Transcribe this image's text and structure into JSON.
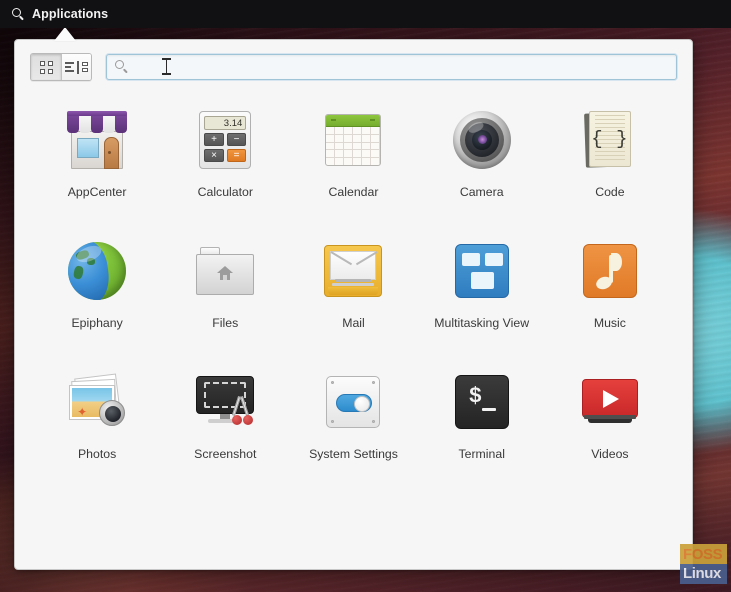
{
  "panel": {
    "menu_label": "Applications",
    "search_icon": "search-icon"
  },
  "toolbar": {
    "grid_view_icon": "grid-view-icon",
    "category_view_icon": "category-view-icon",
    "grid_view_active": true
  },
  "search": {
    "value": "",
    "placeholder": "",
    "icon": "magnifier-icon",
    "cursor": "text-ibeam-cursor"
  },
  "apps": [
    {
      "label": "AppCenter",
      "icon": "appcenter-icon"
    },
    {
      "label": "Calculator",
      "icon": "calculator-icon"
    },
    {
      "label": "Calendar",
      "icon": "calendar-icon"
    },
    {
      "label": "Camera",
      "icon": "camera-icon"
    },
    {
      "label": "Code",
      "icon": "code-icon"
    },
    {
      "label": "Epiphany",
      "icon": "epiphany-globe-icon"
    },
    {
      "label": "Files",
      "icon": "files-folder-icon"
    },
    {
      "label": "Mail",
      "icon": "mail-envelope-icon"
    },
    {
      "label": "Multitasking View",
      "icon": "multitasking-view-icon"
    },
    {
      "label": "Music",
      "icon": "music-note-icon"
    },
    {
      "label": "Photos",
      "icon": "photos-icon"
    },
    {
      "label": "Screenshot",
      "icon": "screenshot-scissors-icon"
    },
    {
      "label": "System Settings",
      "icon": "system-settings-toggle-icon"
    },
    {
      "label": "Terminal",
      "icon": "terminal-prompt-icon"
    },
    {
      "label": "Videos",
      "icon": "videos-play-icon"
    }
  ],
  "calculator_icon": {
    "display": "3.14",
    "keys": [
      "+",
      "−",
      "×",
      "="
    ]
  },
  "code_icon": {
    "braces": "{ }"
  },
  "terminal_icon": {
    "prompt": "$"
  },
  "watermark": {
    "line1": "FOSS",
    "line2": "Linux"
  },
  "colors": {
    "panel_bg": "#111013",
    "window_bg": "#f6f6f6",
    "accent_blue": "#2f8ccd",
    "search_border": "#9fc4d8",
    "label_text": "#3a3a3a"
  }
}
